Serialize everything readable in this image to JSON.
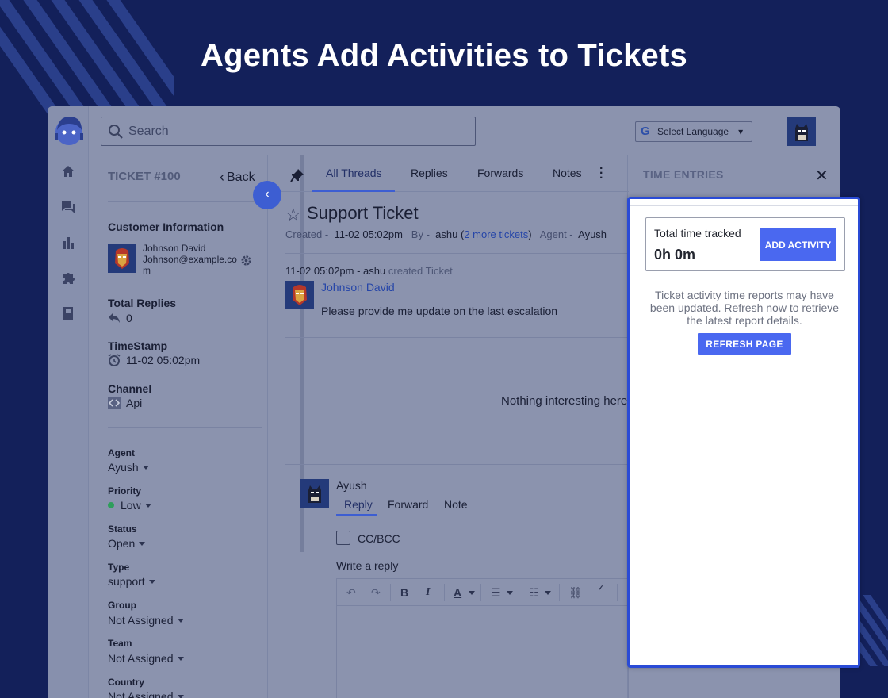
{
  "headline": "Agents Add Activities to Tickets",
  "topbar": {
    "search_placeholder": "Search",
    "language_label": "Select Language",
    "language_caret": "▾"
  },
  "ticket": {
    "number": "TICKET #100",
    "back_label": "Back",
    "title": "Support Ticket",
    "created_label": "Created -",
    "created_value": "11-02 05:02pm",
    "by_label": "By -",
    "by_value": "ashu",
    "more_tickets": "2 more tickets",
    "agent_label": "Agent -",
    "agent_value": "Ayush"
  },
  "sidebar": {
    "customer_info_heading": "Customer Information",
    "customer_name": "Johnson David",
    "customer_email": "Johnson@example.com",
    "total_replies_heading": "Total Replies",
    "total_replies_value": "0",
    "timestamp_heading": "TimeStamp",
    "timestamp_value": "11-02 05:02pm",
    "channel_heading": "Channel",
    "channel_value": "Api",
    "fields": [
      {
        "label": "Agent",
        "value": "Ayush"
      },
      {
        "label": "Priority",
        "value": "Low",
        "dot_color": "#2e9e5b"
      },
      {
        "label": "Status",
        "value": "Open"
      },
      {
        "label": "Type",
        "value": "support"
      },
      {
        "label": "Group",
        "value": "Not Assigned"
      },
      {
        "label": "Team",
        "value": "Not Assigned"
      },
      {
        "label": "Country",
        "value": "Not Assigned"
      }
    ]
  },
  "tabs": [
    "All Threads",
    "Replies",
    "Forwards",
    "Notes"
  ],
  "thread": {
    "meta_time": "11-02 05:02pm - ashu",
    "meta_action": "created Ticket",
    "author": "Johnson David",
    "message": "Please provide me update on the last escalation",
    "empty_text": "Nothing interesting here"
  },
  "reply": {
    "agent_name": "Ayush",
    "tabs": [
      "Reply",
      "Forward",
      "Note"
    ],
    "cc_label": "CC/BCC",
    "write_label": "Write a reply"
  },
  "time_entries": {
    "title": "TIME ENTRIES",
    "tracked_label": "Total time tracked",
    "tracked_value": "0h 0m",
    "add_button": "ADD ACTIVITY",
    "notice": "Ticket activity time reports may have been updated. Refresh now to retrieve the latest report details.",
    "refresh_button": "REFRESH PAGE"
  },
  "colors": {
    "accent": "#4a68f0",
    "highlight_border": "#2a4bd6",
    "background": "#13205a"
  }
}
